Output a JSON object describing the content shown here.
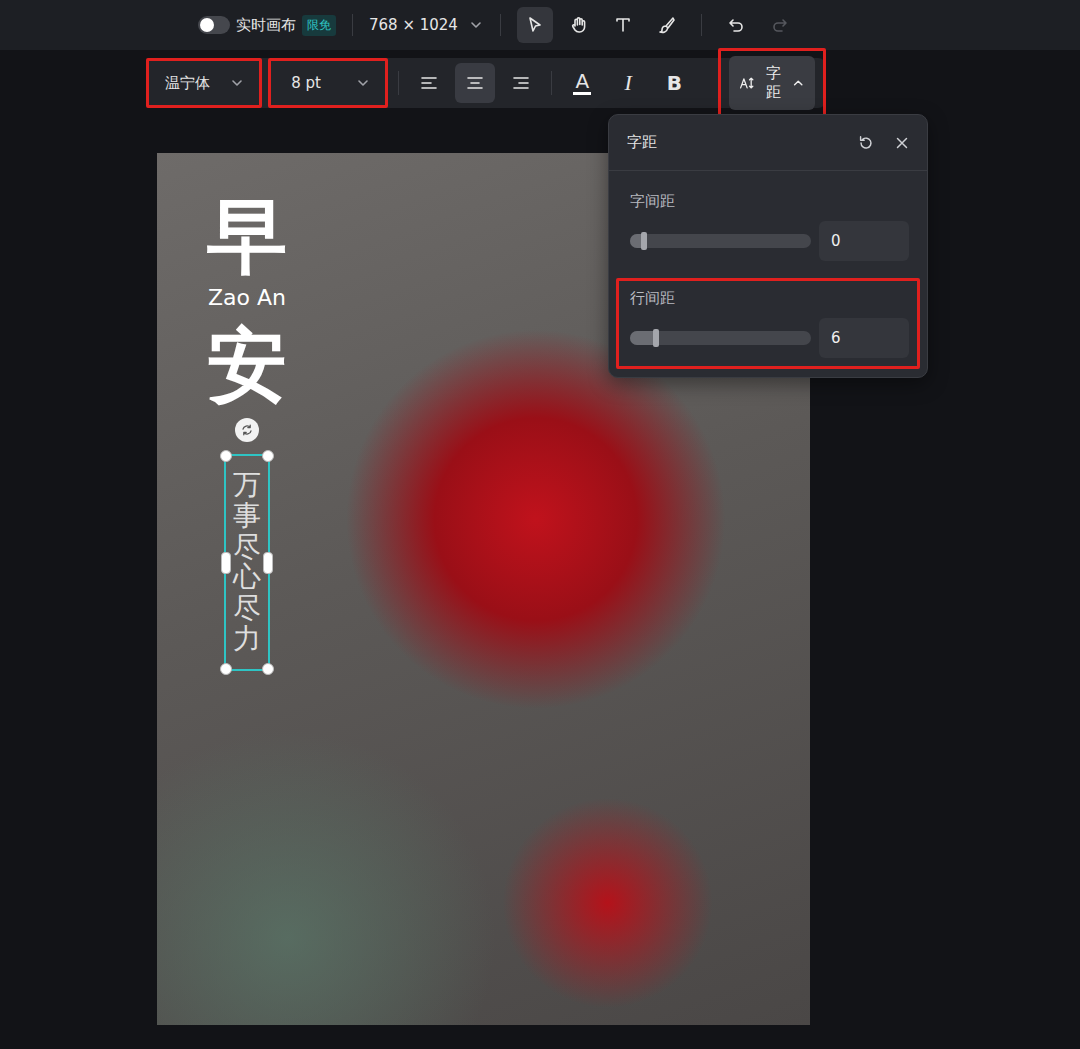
{
  "topbar": {
    "live_canvas": {
      "label": "实时画布",
      "on": false
    },
    "badge": "限免",
    "canvas_size": "768 × 1024",
    "tools": [
      {
        "name": "select",
        "selected": true
      },
      {
        "name": "hand",
        "selected": false
      },
      {
        "name": "text",
        "selected": false
      },
      {
        "name": "brush",
        "selected": false
      }
    ],
    "history": [
      {
        "name": "undo",
        "disabled": false
      },
      {
        "name": "redo",
        "disabled": true
      }
    ]
  },
  "text_toolbar": {
    "font": {
      "value": "温宁体",
      "highlighted": true
    },
    "size": {
      "value": "8 pt",
      "highlighted": true
    },
    "align": [
      {
        "name": "left",
        "selected": false
      },
      {
        "name": "center",
        "selected": true
      },
      {
        "name": "right",
        "selected": false
      }
    ],
    "styles": [
      {
        "name": "color",
        "glyph": "A"
      },
      {
        "name": "italic",
        "glyph": "I"
      },
      {
        "name": "bold",
        "glyph": "B"
      }
    ],
    "spacing_button": {
      "label": "字距",
      "expanded": true,
      "highlighted": true
    }
  },
  "popover": {
    "title": "字距",
    "sliders": [
      {
        "label": "字间距",
        "level": 0.08,
        "value": "0",
        "highlighted": false
      },
      {
        "label": "行间距",
        "level": 0.145,
        "value": "6",
        "highlighted": true
      }
    ]
  },
  "canvas": {
    "layers": [
      {
        "text": "早",
        "kind": "title",
        "selected": false
      },
      {
        "text": "Zao An",
        "kind": "subtitle",
        "selected": false
      },
      {
        "text": "安",
        "kind": "title",
        "selected": false
      },
      {
        "text": "万事尽心尽力",
        "kind": "vertical",
        "selected": true
      }
    ]
  }
}
